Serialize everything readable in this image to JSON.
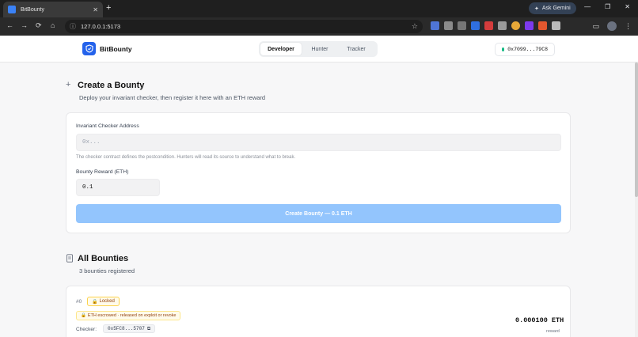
{
  "browser": {
    "tab_title": "BitBounty",
    "tab_close": "✕",
    "new_tab": "+",
    "url": "127.0.0.1:5173",
    "ask_gemini": "Ask Gemini",
    "window_minimize": "—",
    "window_restore": "❐",
    "window_close": "✕"
  },
  "header": {
    "brand": "BitBounty",
    "tabs": [
      {
        "label": "Developer",
        "active": true
      },
      {
        "label": "Hunter",
        "active": false
      },
      {
        "label": "Tracker",
        "active": false
      }
    ],
    "wallet_address": "0x7099...79C8",
    "wallet_status_color": "#10b981"
  },
  "create": {
    "title": "Create a Bounty",
    "subtitle": "Deploy your invariant checker, then register it here with an ETH reward",
    "checker_label": "Invariant Checker Address",
    "checker_placeholder": "0x...",
    "checker_value": "",
    "hint": "The checker contract defines the postcondition. Hunters will read its source to understand what to break.",
    "reward_label": "Bounty Reward (ETH)",
    "reward_value": "0.1",
    "submit_label": "Create Bounty — 0.1 ETH"
  },
  "bounties": {
    "title": "All Bounties",
    "subtitle": "3 bounties registered",
    "items": [
      {
        "number": "#0",
        "status": "Locked",
        "escrow_note": "ETH escrowed · released on exploit or revoke",
        "checker_label": "Checker:",
        "checker_address": "0x5FC8...5707",
        "reward": "0.000100 ETH",
        "reward_label": "reward"
      }
    ]
  },
  "colors": {
    "accent": "#2563eb",
    "submit_disabled": "#93c5fd",
    "locked_badge": "#92400e"
  }
}
